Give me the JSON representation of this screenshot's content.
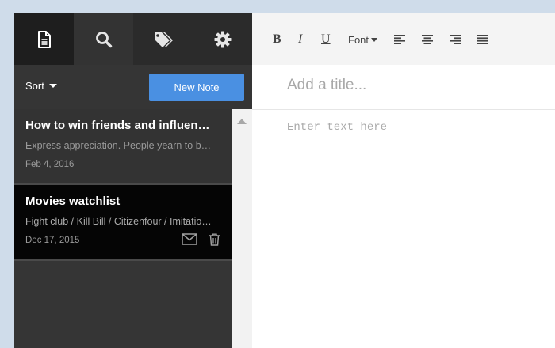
{
  "sidebar": {
    "tabs": [
      {
        "name": "notes",
        "icon": "document-icon",
        "active": true
      },
      {
        "name": "search",
        "icon": "search-icon",
        "active": false
      },
      {
        "name": "tags",
        "icon": "tags-icon",
        "active": false
      },
      {
        "name": "settings",
        "icon": "gear-icon",
        "active": false
      }
    ],
    "sort_label": "Sort",
    "new_note_label": "New Note",
    "notes": [
      {
        "title": "How to win friends and influence people",
        "excerpt": "Express appreciation. People yearn to be appreciated",
        "date": "Feb 4, 2016",
        "active": false
      },
      {
        "title": "Movies watchlist",
        "excerpt": "Fight club / Kill Bill / Citizenfour / Imitation Game",
        "date": "Dec 17, 2015",
        "active": true
      }
    ]
  },
  "editor": {
    "format_buttons": {
      "bold": "B",
      "italic": "I",
      "underline": "U",
      "font": "Font"
    },
    "title_placeholder": "Add a title...",
    "body_placeholder": "Enter text here"
  },
  "colors": {
    "accent": "#4a90e2",
    "sidebar_bg": "#353535",
    "tabbar_bg": "#2b2b2b",
    "active_note_bg": "#050505"
  }
}
